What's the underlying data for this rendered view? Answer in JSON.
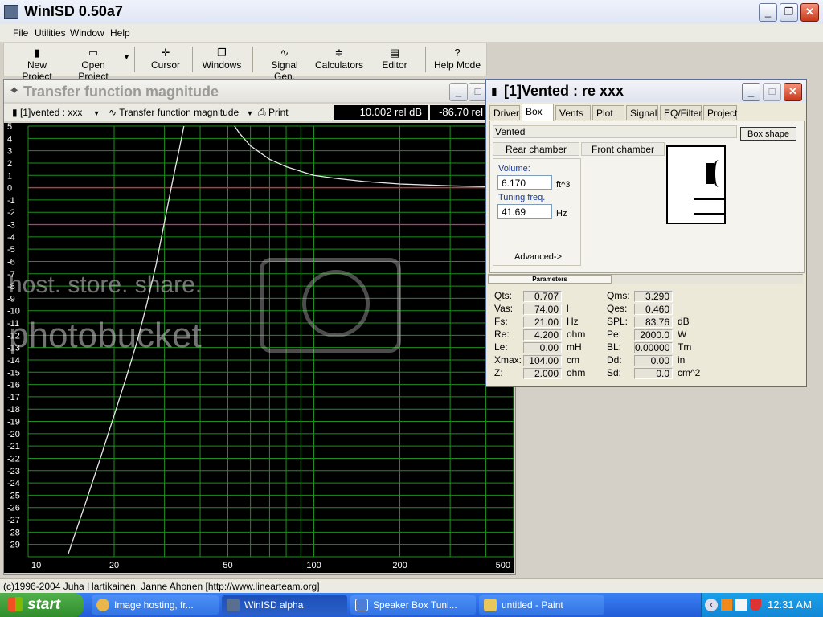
{
  "app": {
    "title": "WinISD 0.50a7",
    "controls": [
      "_",
      "❐",
      "✕"
    ]
  },
  "menu": [
    "File",
    "Utilities",
    "Window",
    "Help"
  ],
  "toolbar": [
    {
      "label": "New Project",
      "icon": "file-icon"
    },
    {
      "label": "Open Project",
      "icon": "folder-open-icon"
    },
    {
      "label": "Cursor",
      "icon": "cursor-icon"
    },
    {
      "label": "Windows",
      "icon": "windows-icon"
    },
    {
      "label": "Signal Gen.",
      "icon": "signal-icon"
    },
    {
      "label": "Calculators",
      "icon": "calculator-icon"
    },
    {
      "label": "Editor",
      "icon": "editor-icon"
    },
    {
      "label": "Help Mode",
      "icon": "help-icon"
    }
  ],
  "plot_window": {
    "title": "Transfer function magnitude",
    "project_select": "[1]vented : xxx",
    "graph_select": "Transfer function magnitude",
    "print_label": "Print",
    "readout_left": "10.002 rel dB",
    "readout_right": "-86.70 rel"
  },
  "chart_data": {
    "type": "line",
    "xscale": "log",
    "xlim": [
      10,
      500
    ],
    "ylim": [
      -30,
      5
    ],
    "x_ticks": [
      "10",
      "20",
      "50",
      "100",
      "200",
      "500"
    ],
    "y_ticks": [
      "5",
      "4",
      "3",
      "2",
      "1",
      "0",
      "-1",
      "-2",
      "-3",
      "-4",
      "-5",
      "-6",
      "-7",
      "-8",
      "-9",
      "-10",
      "-11",
      "-12",
      "-13",
      "-14",
      "-15",
      "-16",
      "-17",
      "-18",
      "-19",
      "-20",
      "-21",
      "-22",
      "-23",
      "-24",
      "-25",
      "-26",
      "-27",
      "-28",
      "-29"
    ],
    "grid": true,
    "colors": {
      "background": "#000000",
      "grid": "#1e8f1e",
      "curve": "#e8e8e8",
      "zero_line": "#d23232",
      "minus3_line": "#c8327a"
    },
    "series": [
      {
        "segments": [
          {
            "x": [
              13.8,
              16,
              18,
              20,
              22,
              24,
              26,
              28,
              30,
              32,
              34,
              35.5
            ],
            "y": [
              -29.8,
              -25.4,
              -21.8,
              -18.5,
              -15.5,
              -12.6,
              -9.5,
              -6.3,
              -2.8,
              0.5,
              3.4,
              5.6
            ]
          },
          {
            "x": [
              50,
              55,
              60,
              70,
              80,
              100,
              120,
              150,
              200,
              300,
              400,
              500
            ],
            "y": [
              5.8,
              4.4,
              3.4,
              2.3,
              1.7,
              1.0,
              0.75,
              0.5,
              0.3,
              0.15,
              0.08,
              0.05
            ]
          }
        ]
      }
    ],
    "reference_lines": [
      0,
      -3
    ]
  },
  "watermark": {
    "line1": "host. store. share.",
    "line2": "photobucket"
  },
  "vent_window": {
    "title": "[1]Vented : re xxx",
    "tabs": [
      "Driver",
      "Box",
      "Vents",
      "Plot",
      "Signal",
      "EQ/Filter",
      "Project"
    ],
    "active_tab": "Box",
    "box_type": "Vented",
    "box_shape_btn": "Box shape",
    "rear_chamber_btn": "Rear chamber",
    "front_chamber_btn": "Front chamber",
    "volume_label": "Volume:",
    "volume_value": "6.170",
    "volume_unit": "ft^3",
    "tuning_label": "Tuning freq.",
    "tuning_value": "41.69",
    "tuning_unit": "Hz",
    "advanced": "Advanced->",
    "params_header": "Parameters",
    "params_left": [
      {
        "label": "Qts:",
        "value": "0.707",
        "unit": ""
      },
      {
        "label": "Vas:",
        "value": "74.00",
        "unit": "l"
      },
      {
        "label": "Fs:",
        "value": "21.00",
        "unit": "Hz"
      },
      {
        "label": "Re:",
        "value": "4.200",
        "unit": "ohm"
      },
      {
        "label": "Le:",
        "value": "0.00",
        "unit": "mH"
      },
      {
        "label": "Xmax:",
        "value": "104.00",
        "unit": "cm"
      },
      {
        "label": "Z:",
        "value": "2.000",
        "unit": "ohm"
      }
    ],
    "params_right": [
      {
        "label": "Qms:",
        "value": "3.290",
        "unit": ""
      },
      {
        "label": "Qes:",
        "value": "0.460",
        "unit": ""
      },
      {
        "label": "SPL:",
        "value": "83.76",
        "unit": "dB"
      },
      {
        "label": "Pe:",
        "value": "2000.0",
        "unit": "W"
      },
      {
        "label": "BL:",
        "value": "0.00000",
        "unit": "Tm"
      },
      {
        "label": "Dd:",
        "value": "0.00",
        "unit": "in"
      },
      {
        "label": "Sd:",
        "value": "0.0",
        "unit": "cm^2"
      }
    ]
  },
  "statusbar": "(c)1996-2004 Juha Hartikainen, Janne Ahonen [http://www.linearteam.org]",
  "taskbar": {
    "start": "start",
    "tasks": [
      {
        "label": "Image hosting, fr...",
        "color": "#e8b64a"
      },
      {
        "label": "WinISD alpha",
        "color": "#5a6f8f"
      },
      {
        "label": "Speaker Box Tuni...",
        "color": "#4e7fd8"
      },
      {
        "label": "untitled - Paint",
        "color": "#e8c85a"
      }
    ],
    "clock": "12:31 AM"
  }
}
